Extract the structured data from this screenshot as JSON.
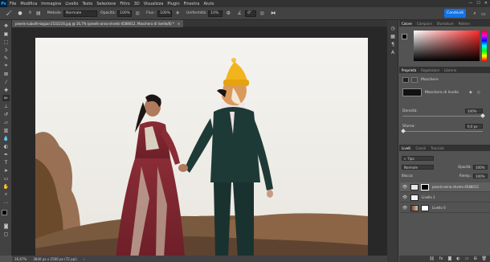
{
  "menubar": {
    "logo": "Ps",
    "items": [
      "File",
      "Modifica",
      "Immagine",
      "Livello",
      "Testo",
      "Selezione",
      "Filtro",
      "3D",
      "Visualizza",
      "Plugin",
      "Finestra",
      "Aiuto"
    ],
    "window_controls": [
      "—",
      "☐",
      "✕"
    ]
  },
  "options": {
    "size": "0",
    "metodo_label": "Metodo:",
    "metodo_value": "Normale",
    "opacita_label": "Opacità:",
    "opacita_value": "100%",
    "flusso_label": "Flus.:",
    "flusso_value": "100%",
    "uniformita_label": "Uniformità:",
    "uniformita_value": "10%",
    "angle_value": "0°",
    "share_label": "Condividi"
  },
  "document": {
    "tab_title": "pexels-subodh-bajpai-2532216.jpg @ 16,7% (pexels-anna-shvets-4588012, Maschera di livello/8) *",
    "tab_close": "×",
    "zoom": "16,67%",
    "doc_info": "3840 px x 2560 px (72 ppi)"
  },
  "color_panel": {
    "tabs": [
      "Colore",
      "Campioni",
      "Sfumature",
      "Pattern"
    ],
    "active_tab": 0,
    "colors": {
      "hue_red": "#ff2b2b",
      "field_dark": "#2a0000",
      "accent": "#1473e6"
    }
  },
  "properties_panel": {
    "tabs": [
      "Proprietà",
      "Regolazioni",
      "Librerie"
    ],
    "active_tab": 0,
    "section_label": "Maschere",
    "mask_label": "Maschera di livello",
    "density_label": "Densità:",
    "density_value": "100%",
    "feather_label": "Sfuma:",
    "feather_value": "0,0 px"
  },
  "layers_panel": {
    "tabs": [
      "Livelli",
      "Canali",
      "Tracciati"
    ],
    "active_tab": 0,
    "filter_label": "Tipo",
    "blend_mode": "Normale",
    "opacity_label": "Opacità:",
    "opacity_value": "100%",
    "lock_label": "Blocca:",
    "fill_label": "Riemp.:",
    "fill_value": "100%",
    "layers": [
      {
        "name": "pexels-anna-shvets-4588012",
        "selected": true
      },
      {
        "name": "Livello 1",
        "selected": false
      },
      {
        "name": "Livello 0",
        "selected": false
      }
    ]
  },
  "icons": {
    "toolbar": [
      "move-icon",
      "artboard-icon",
      "marquee-icon",
      "lasso-icon",
      "quick-select-icon",
      "crop-icon",
      "frame-icon",
      "eyedropper-icon",
      "healing-icon",
      "brush-icon",
      "stamp-icon",
      "history-brush-icon",
      "eraser-icon",
      "gradient-icon",
      "blur-icon",
      "dodge-icon",
      "pen-icon",
      "type-icon",
      "path-select-icon",
      "rectangle-icon",
      "hand-icon",
      "zoom-icon",
      "more-icon"
    ]
  }
}
